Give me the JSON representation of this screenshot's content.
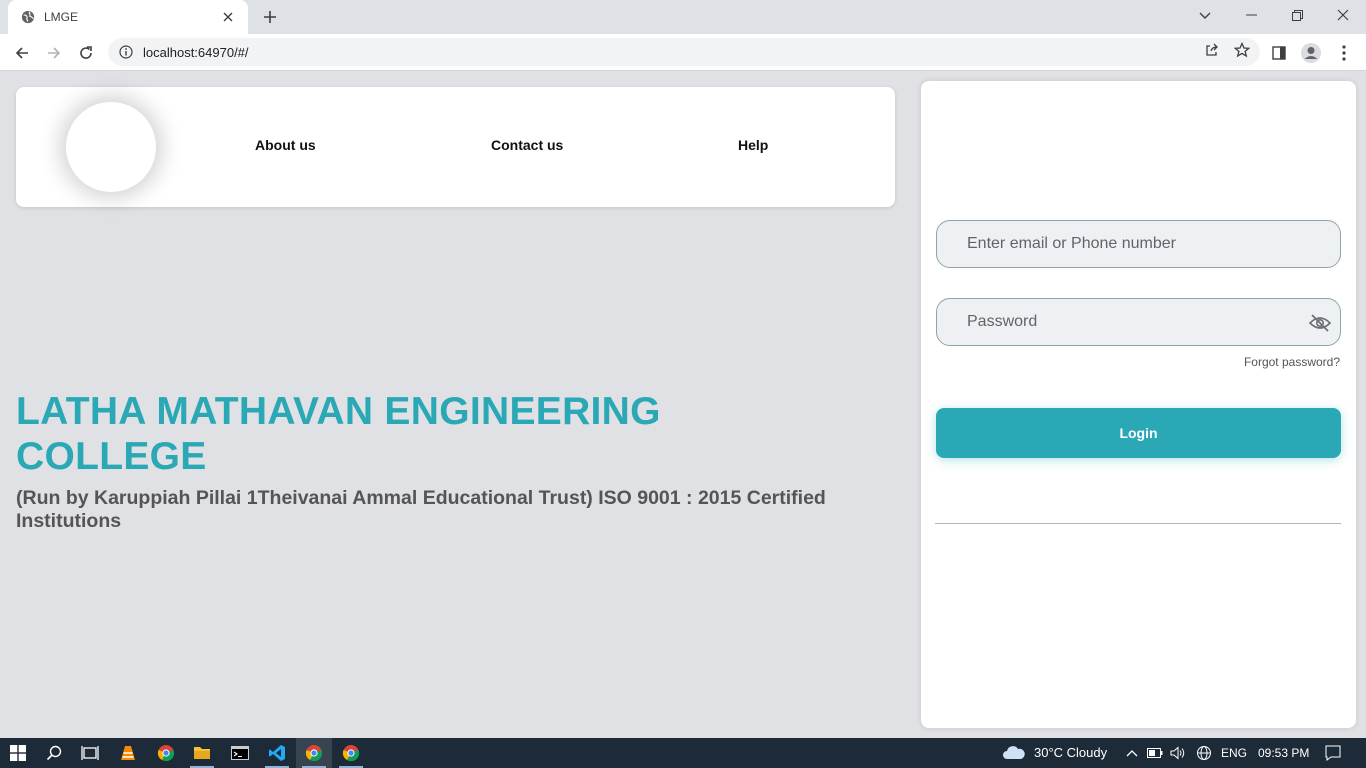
{
  "browser": {
    "tab_title": "LMGE",
    "url": "localhost:64970/#/"
  },
  "nav": {
    "links": [
      "About us",
      "Contact us",
      "Help"
    ]
  },
  "college": {
    "title": "LATHA MATHAVAN ENGINEERING\n COLLEGE",
    "subtitle": "(Run by Karuppiah Pillai 1Theivanai Ammal Educational Trust) ISO 9001 : 2015 Certified Institutions"
  },
  "login": {
    "email_placeholder": "Enter email or Phone number",
    "password_placeholder": "Password",
    "forgot_label": "Forgot password?",
    "login_label": "Login"
  },
  "taskbar": {
    "weather": "30°C  Cloudy",
    "language": "ENG",
    "time": "09:53 PM"
  },
  "colors": {
    "accent": "#2ba8b5",
    "page_bg": "#e0e1e5",
    "taskbar_bg": "#1d2a38"
  }
}
